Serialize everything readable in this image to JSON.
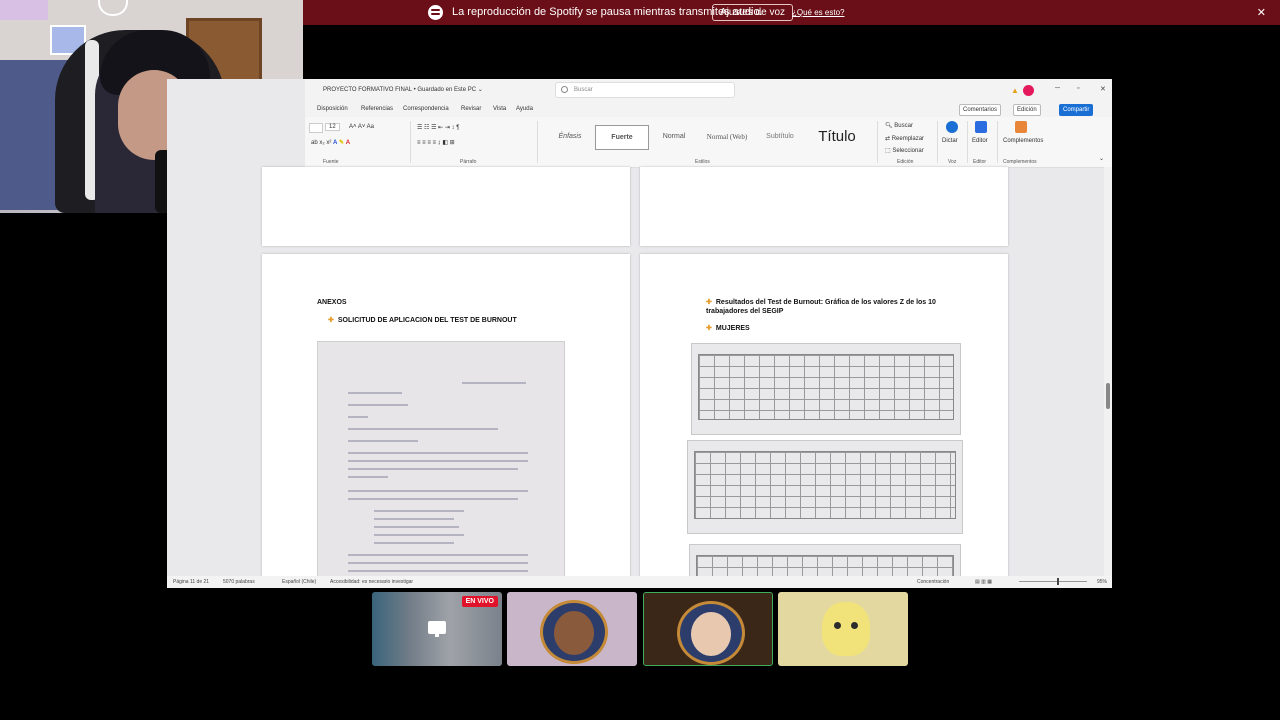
{
  "banner": {
    "message": "La reproducción de Spotify se pausa mientras transmites audio.",
    "button": "Ajustes de voz",
    "link": "¿Qué es esto?",
    "close": "✕"
  },
  "word": {
    "title": "PROYECTO FORMATIVO FINAL • Guardado en Este PC ⌄",
    "search_placeholder": "Buscar",
    "menu": [
      "Disposición",
      "Referencias",
      "Correspondencia",
      "Revisar",
      "Vista",
      "Ayuda"
    ],
    "comments": "Comentarios",
    "editing": "Edición",
    "share": "Compartir",
    "ribbon": {
      "font_size": "12",
      "styles": [
        "Énfasis",
        "Fuerte",
        "Normal",
        "Normal (Web)",
        "Subtítulo",
        "Título"
      ],
      "find": "Buscar",
      "replace": "Reemplazar",
      "select": "Seleccionar",
      "dictate": "Dictar",
      "editor": "Editor",
      "addins": "Complementos",
      "groups": {
        "font": "Fuente",
        "paragraph": "Párrafo",
        "styles": "Estilos",
        "editing": "Edición",
        "voice": "Voz",
        "editor": "Editor",
        "addins": "Complementos"
      }
    },
    "left_page": {
      "heading": "ANEXOS",
      "bullet": "SOLICITUD DE APLICACION DEL TEST DE BURNOUT"
    },
    "right_page": {
      "bullet1": "Resultados del Test de Burnout: Gráfica de los valores Z de los 10 trabajadores del SEGIP",
      "bullet2": "MUJERES"
    },
    "status": {
      "page": "Página 11 de 21",
      "words": "5070 palabras",
      "language": "Español (Chile)",
      "accessibility": "Accesibilidad: es necesario investigar",
      "focus": "Concentración",
      "zoom": "95%"
    }
  },
  "participants": [
    {
      "name": "screen-share",
      "live": "EN VIVO",
      "bg": "#3a3f4a"
    },
    {
      "name": "participant-2",
      "bg": "#c9b7c9"
    },
    {
      "name": "participant-3",
      "bg": "#3a2718"
    },
    {
      "name": "participant-4",
      "bg": "#e3d8a0"
    }
  ]
}
